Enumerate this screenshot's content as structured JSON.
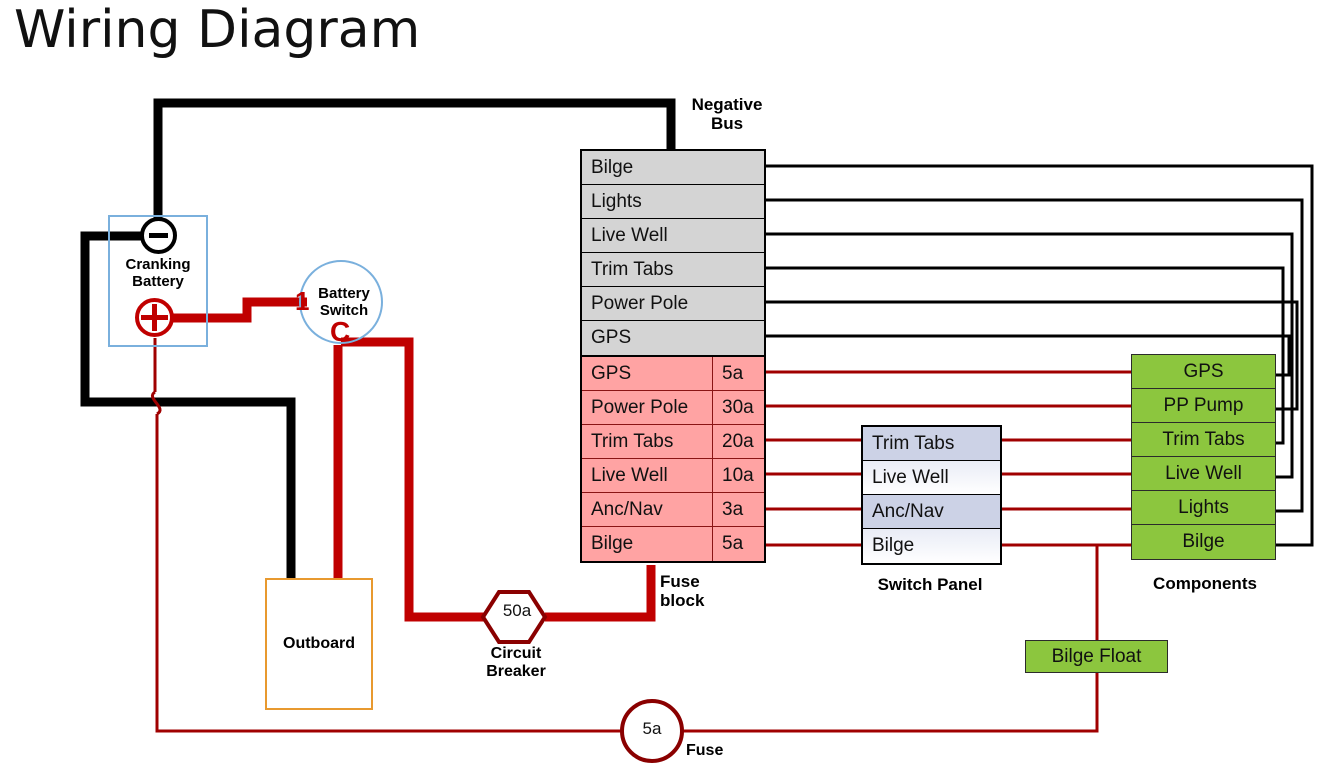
{
  "title": "Wiring Diagram",
  "labels": {
    "negative_bus": "Negative\nBus",
    "fuse_block": "Fuse\nblock",
    "switch_panel": "Switch Panel",
    "components": "Components",
    "circuit_breaker": "Circuit\nBreaker",
    "fuse": "Fuse",
    "cranking_battery": "Cranking\nBattery",
    "battery_switch": "Battery\nSwitch",
    "outboard": "Outboard",
    "bilge_float": "Bilge Float"
  },
  "battery_switch": {
    "terminal_1": "1",
    "terminal_c": "C"
  },
  "circuit_breaker": {
    "rating": "50a"
  },
  "inline_fuse": {
    "rating": "5a"
  },
  "negative_bus": {
    "rows": [
      {
        "name": "Bilge"
      },
      {
        "name": "Lights"
      },
      {
        "name": "Live Well"
      },
      {
        "name": "Trim Tabs"
      },
      {
        "name": "Power Pole"
      },
      {
        "name": "GPS"
      }
    ]
  },
  "fuse_block": {
    "rows": [
      {
        "name": "GPS",
        "amp": "5a"
      },
      {
        "name": "Power Pole",
        "amp": "30a"
      },
      {
        "name": "Trim Tabs",
        "amp": "20a"
      },
      {
        "name": "Live Well",
        "amp": "10a"
      },
      {
        "name": "Anc/Nav",
        "amp": "3a"
      },
      {
        "name": "Bilge",
        "amp": "5a"
      }
    ]
  },
  "switch_panel": {
    "rows": [
      {
        "name": "Trim Tabs"
      },
      {
        "name": "Live Well"
      },
      {
        "name": "Anc/Nav"
      },
      {
        "name": "Bilge"
      }
    ]
  },
  "components": {
    "rows": [
      {
        "name": "GPS"
      },
      {
        "name": "PP Pump"
      },
      {
        "name": "Trim Tabs"
      },
      {
        "name": "Live Well"
      },
      {
        "name": "Lights"
      },
      {
        "name": "Bilge"
      }
    ]
  },
  "colors": {
    "negative_wire": "#000000",
    "positive_wire": "#c00000",
    "thin_positive_wire": "#a00000",
    "negative_bus_fill": "#d4d4d4",
    "fuse_fill": "#ffa3a3",
    "fuse_border": "#8a1414",
    "switch_fill_a": "#ccd2e6",
    "switch_fill_b": "#e9ecf6",
    "component_fill": "#8cc63e",
    "battery_outline": "#7ab0dd",
    "outboard_outline": "#e8992f"
  }
}
